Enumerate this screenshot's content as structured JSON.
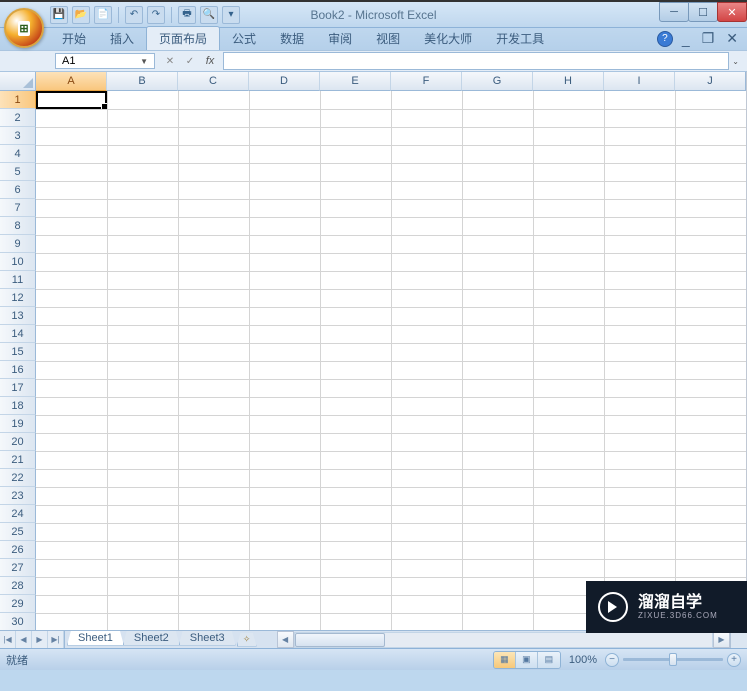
{
  "title": "Book2 - Microsoft Excel",
  "qat_icons": [
    "save-icon",
    "open-icon",
    "new-icon",
    "undo-icon",
    "redo-icon",
    "print-icon",
    "preview-icon",
    "refresh-icon"
  ],
  "ribbon_tabs": [
    "开始",
    "插入",
    "页面布局",
    "公式",
    "数据",
    "审阅",
    "视图",
    "美化大师",
    "开发工具"
  ],
  "active_tab_index": 2,
  "name_box": "A1",
  "fx_label": "fx",
  "formula_value": "",
  "columns": [
    "A",
    "B",
    "C",
    "D",
    "E",
    "F",
    "G",
    "H",
    "I",
    "J"
  ],
  "active_column_index": 0,
  "rows": [
    1,
    2,
    3,
    4,
    5,
    6,
    7,
    8,
    9,
    10,
    11,
    12,
    13,
    14,
    15,
    16,
    17,
    18,
    19,
    20,
    21,
    22,
    23,
    24,
    25,
    26,
    27,
    28,
    29,
    30
  ],
  "active_row_index": 0,
  "sheet_tabs": [
    "Sheet1",
    "Sheet2",
    "Sheet3"
  ],
  "active_sheet_index": 0,
  "status_text": "就绪",
  "zoom_label": "100%",
  "watermark": {
    "brand": "溜溜自学",
    "sub": "ZIXUE.3D66.COM"
  }
}
